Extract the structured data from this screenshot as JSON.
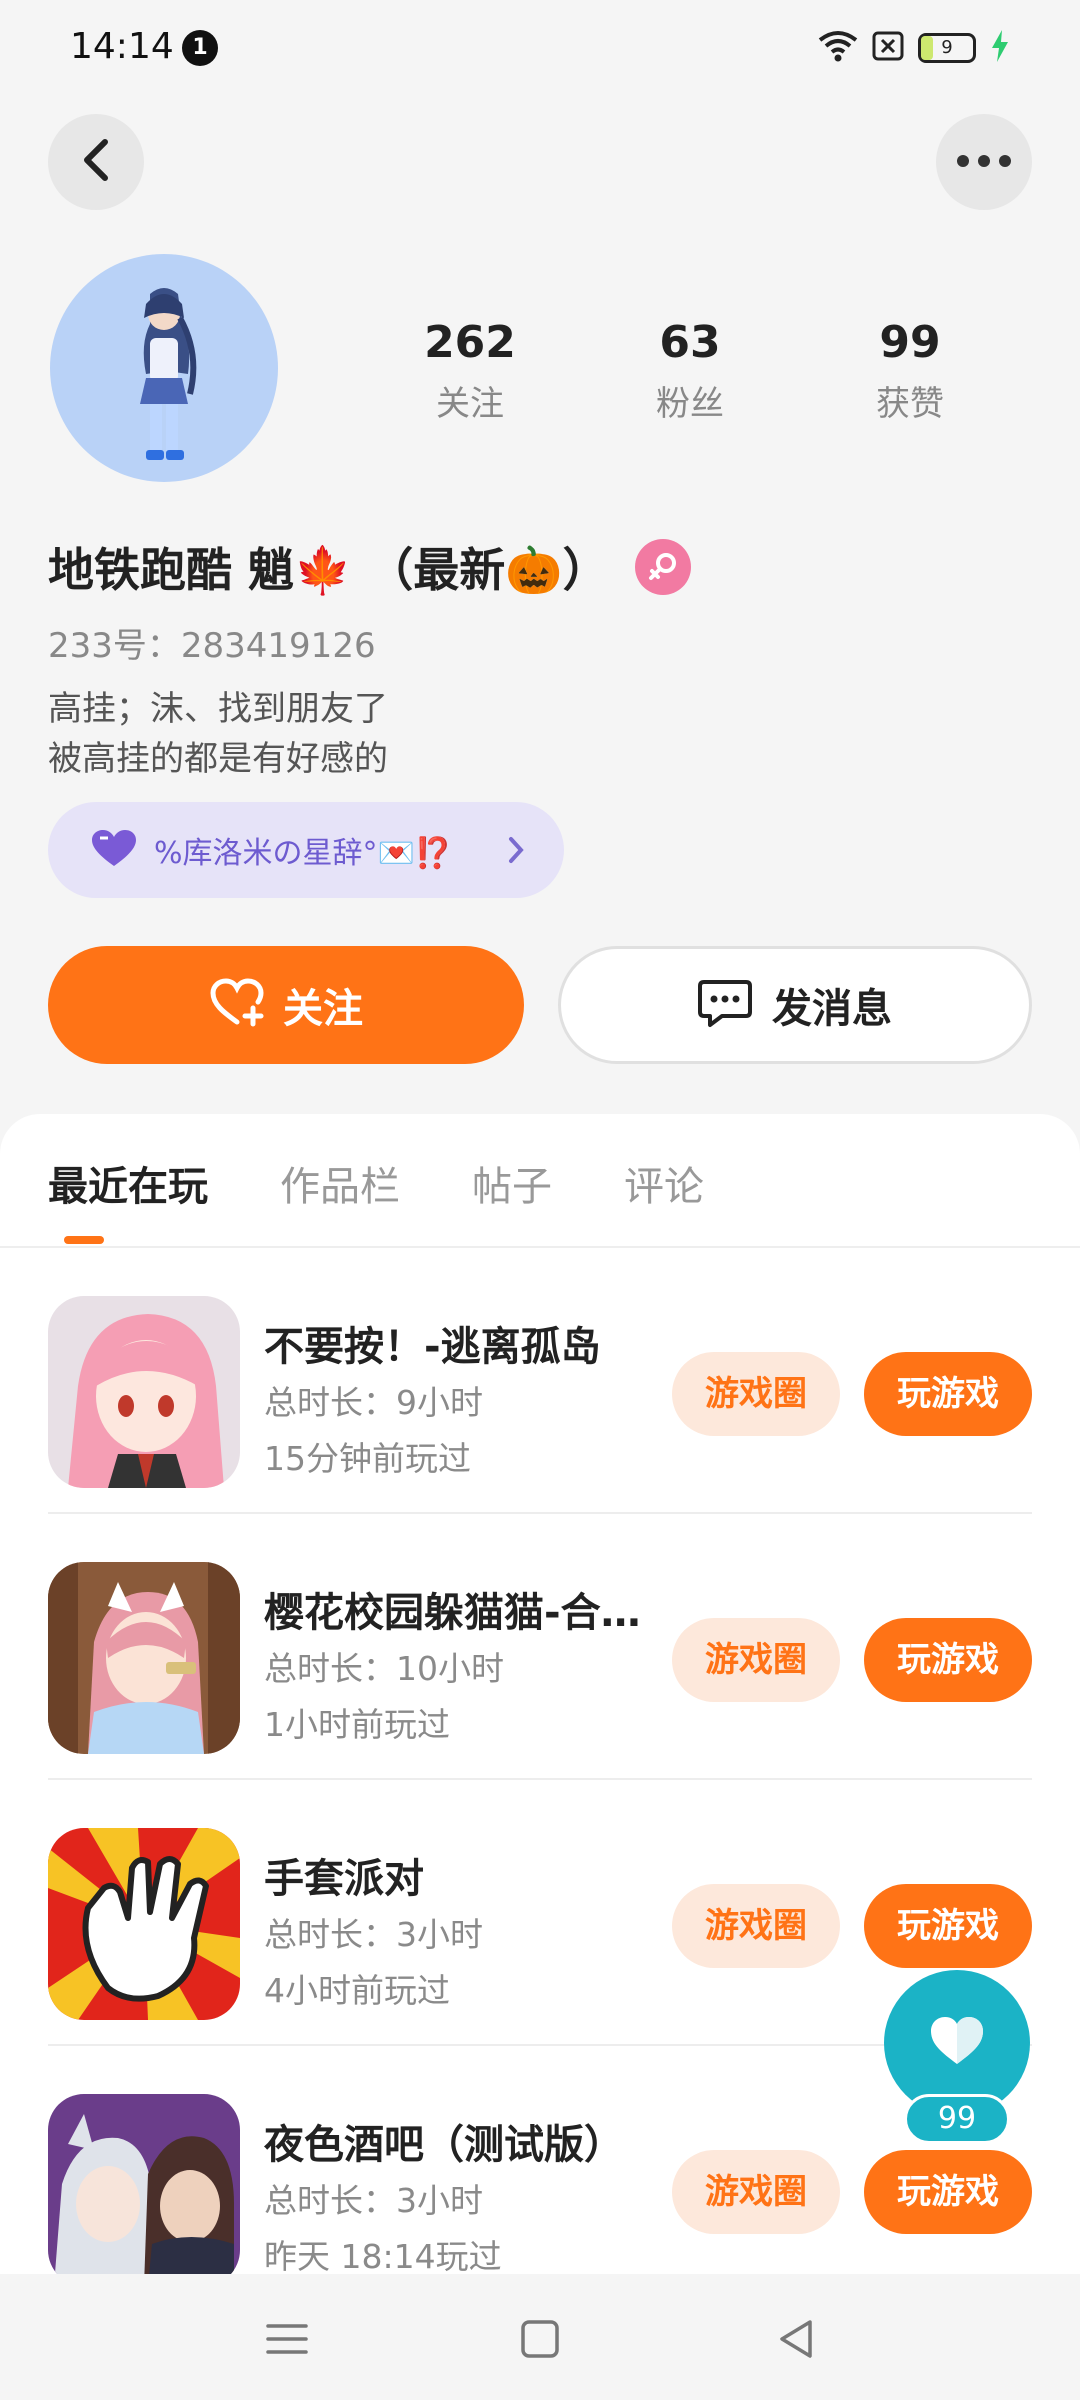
{
  "status_bar": {
    "time": "14:14",
    "notification_count": "1",
    "battery_level": "9"
  },
  "profile": {
    "stats": [
      {
        "value": "262",
        "label": "关注"
      },
      {
        "value": "63",
        "label": "粉丝"
      },
      {
        "value": "99",
        "label": "获赞"
      }
    ],
    "nickname": "地铁跑酷 魈🍁 （最新🎃）",
    "user_id": "233号：283419126",
    "bio_line1": "高挂；沫、找到朋友了",
    "bio_line2": "被高挂的都是有好感的",
    "tag": "%库洛米の星辞°💌⁉️",
    "follow_label": "关注",
    "message_label": "发消息"
  },
  "tabs": [
    "最近在玩",
    "作品栏",
    "帖子",
    "评论"
  ],
  "games": [
    {
      "title": "不要按！-逃离孤岛",
      "duration": "总时长：9小时",
      "last_played": "15分钟前玩过"
    },
    {
      "title": "樱花校园躲猫猫-合…",
      "duration": "总时长：10小时",
      "last_played": "1小时前玩过"
    },
    {
      "title": "手套派对",
      "duration": "总时长：3小时",
      "last_played": "4小时前玩过"
    },
    {
      "title": "夜色酒吧（测试版）",
      "duration": "总时长：3小时",
      "last_played": "昨天 18:14玩过"
    }
  ],
  "game_actions": {
    "circle": "游戏圈",
    "play": "玩游戏"
  },
  "like_fab": {
    "count": "99"
  },
  "colors": {
    "accent": "#ff7316",
    "like": "#1bb3c6",
    "tag_bg": "#e6e3f8"
  }
}
